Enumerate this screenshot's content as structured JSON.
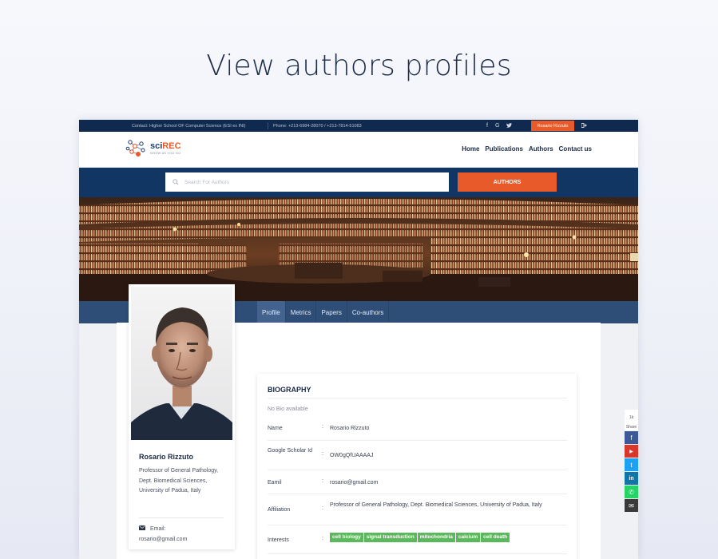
{
  "hero": {
    "title": "View authors profiles"
  },
  "topbar": {
    "contact": "Contact: Higher School OF Computer Science (ESI ex INI)",
    "phone": "Phone: +213-6984-28070 / +213-7814-51083",
    "social": [
      "f",
      "G",
      "t"
    ],
    "user": "Rosario Rizzuto",
    "logout_icon": "logout-icon"
  },
  "brand": {
    "name_part1": "sci",
    "name_part2": "REC",
    "tagline": "GROW AS YOU GO",
    "accent": "#e85a2a",
    "primary": "#1d3f73"
  },
  "nav": {
    "items": [
      "Home",
      "Publications",
      "Authors",
      "Contact us"
    ]
  },
  "search": {
    "placeholder": "Search For Authors",
    "button": "AUTHORS"
  },
  "tabs": [
    "Profile",
    "Metrics",
    "Papers",
    "Co-authors"
  ],
  "profile": {
    "name": "Rosario Rizzuto",
    "role": "Professor of General Pathology, Dept. Biomedical Sciences, University of Padua, Italy",
    "email_label": "Email:",
    "email": "rosario@gmail.com"
  },
  "biography": {
    "title": "BIOGRAPHY",
    "no_bio": "No Bio available",
    "fields": [
      {
        "label": "Name",
        "value": "Rosario Rizzuto"
      },
      {
        "label": "Google Scholar Id",
        "value": "OW0gQfUAAAAJ"
      },
      {
        "label": "Eamil",
        "value": "rosario@gmail.com"
      },
      {
        "label": "Affiliation",
        "value": "Professor of General Pathology, Dept. Biomedical Sciences, University of Padua, Italy"
      },
      {
        "label": "Interests",
        "value": ""
      }
    ],
    "interests": [
      "cell biology",
      "signal transduction",
      "mitochondria",
      "calcium",
      "cell death"
    ],
    "tag_color": "#5cb85c"
  },
  "share": {
    "count": "1k",
    "label": "Share",
    "buttons": [
      "f",
      "▶",
      "t",
      "in",
      "✆",
      "✉"
    ]
  }
}
